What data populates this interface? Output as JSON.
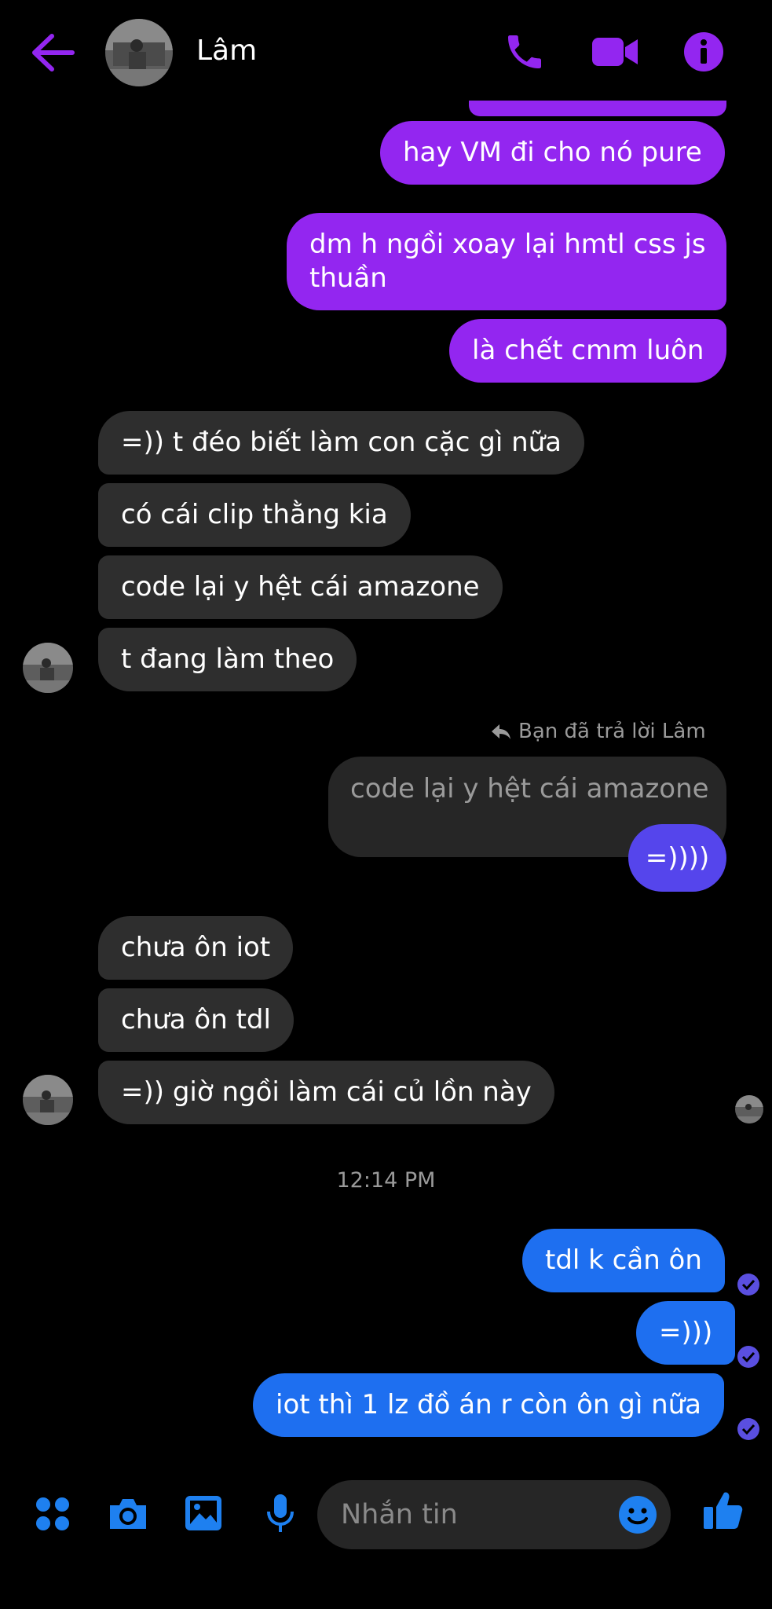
{
  "header": {
    "contact_name": "Lâm",
    "icons": {
      "back": "arrow-left-icon",
      "call": "phone-icon",
      "video": "video-camera-icon",
      "info": "info-icon"
    }
  },
  "messages": {
    "m1": "hay VM đi cho nó pure",
    "m2_line1": "dm h ngồi xoay lại hmtl css js",
    "m2_line2": "thuần",
    "m3": "là chết cmm luôn",
    "m4": "=)) t đéo biết làm con cặc gì nữa",
    "m5": "có cái clip thằng kia",
    "m6": "code lại y hệt cái amazone",
    "m7": "t đang làm theo",
    "reply_label": "Bạn đã trả lời Lâm",
    "quoted_text": "code lại y hệt cái amazone",
    "reply_text": "=))))",
    "m8": "chưa ôn iot",
    "m9": "chưa ôn tdl",
    "m10": "=)) giờ ngồi làm cái củ lồn này",
    "timestamp": "12:14 PM",
    "m11": "tdl k cần ôn",
    "m12": "=)))",
    "m13": "iot thì 1 lz đồ án r còn ôn gì nữa"
  },
  "composer": {
    "placeholder": "Nhắn tin",
    "icons": [
      "menu-grid-icon",
      "camera-icon",
      "image-icon",
      "microphone-icon",
      "emoji-icon",
      "thumbs-up-icon"
    ]
  },
  "colors": {
    "accent_purple": "#9326f0",
    "reply_blue_violet": "#5545ec",
    "outgoing_blue": "#1e6ff0",
    "incoming_gray": "#2e2e2e",
    "icon_blue": "#1e80f0"
  }
}
